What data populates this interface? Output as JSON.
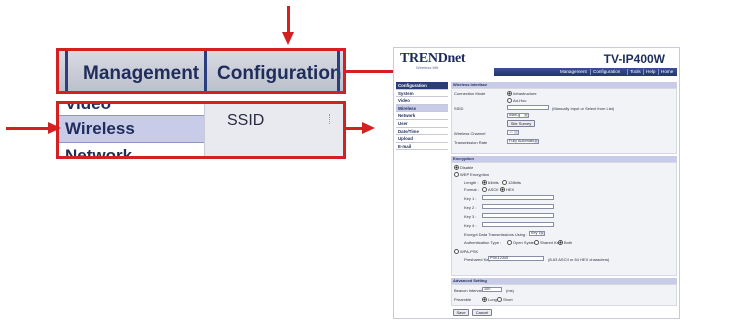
{
  "zoom_nav": {
    "tab1": "Management",
    "tab2": "Configuration"
  },
  "zoom_side": {
    "prev_item": "Video",
    "selected_item": "Wireless",
    "next_item": "Network",
    "content_label": "SSID"
  },
  "screenshot": {
    "logo": "TRENDnet",
    "logo_tagline": "Wireless Mfr",
    "model": "TV-IP400W",
    "nav": [
      "Management",
      "Configuration",
      "Tools",
      "Help",
      "Home"
    ],
    "sidebar": [
      "Configuration",
      "System",
      "Video",
      "Wireless",
      "Network",
      "User",
      "Date/Time",
      "Upload",
      "E-mail"
    ],
    "wireless": {
      "title": "Wireless Interface",
      "connection_mode_label": "Connection Mode",
      "opt_infra": "Infrastructure",
      "opt_adhoc": "Ad-Hoc",
      "ssid_label": "SSID",
      "ssid_hint": "(Manually Input or Select from List)",
      "ssid_select": "wlan-g",
      "site_survey": "Site Survey",
      "channel_label": "Wireless Channel",
      "channel_value": "11",
      "rate_label": "Transmission Rate",
      "rate_value": "Fully Automatic"
    },
    "encryption": {
      "title": "Encryption",
      "disable": "Disable",
      "wep": "WEP Encryption",
      "length_label": "Length :",
      "len64": "64bits",
      "len128": "128bits",
      "format_label": "Format :",
      "ascii": "ASCII",
      "hex": "HEX",
      "key1": "Key 1 :",
      "key2": "Key 2 :",
      "key3": "Key 3 :",
      "key4": "Key 4 :",
      "encrypt_label": "Encrypt Data Transmissions Using :",
      "encrypt_key": "Key 1",
      "auth_label": "Authentication Type :",
      "auth_open": "Open System",
      "auth_shared": "Shared Key",
      "auth_both": "Both",
      "wpa": "WPA-PSK",
      "psk_label": "Preshared Key :",
      "psk_value": "PSK12345",
      "psk_hint": "(8-63 ASCII or 64 HEX characters)"
    },
    "advanced": {
      "title": "Advanced Setting",
      "beacon_label": "Beacon Interval",
      "beacon_value": "100",
      "beacon_unit": "(ms)",
      "preamble_label": "Preamble",
      "long": "Long",
      "short": "Short"
    },
    "save": "Save",
    "cancel": "Cancel"
  },
  "colors": {
    "callout": "#d42020",
    "nav_blue": "#22356f",
    "selected": "#c9cce8"
  }
}
